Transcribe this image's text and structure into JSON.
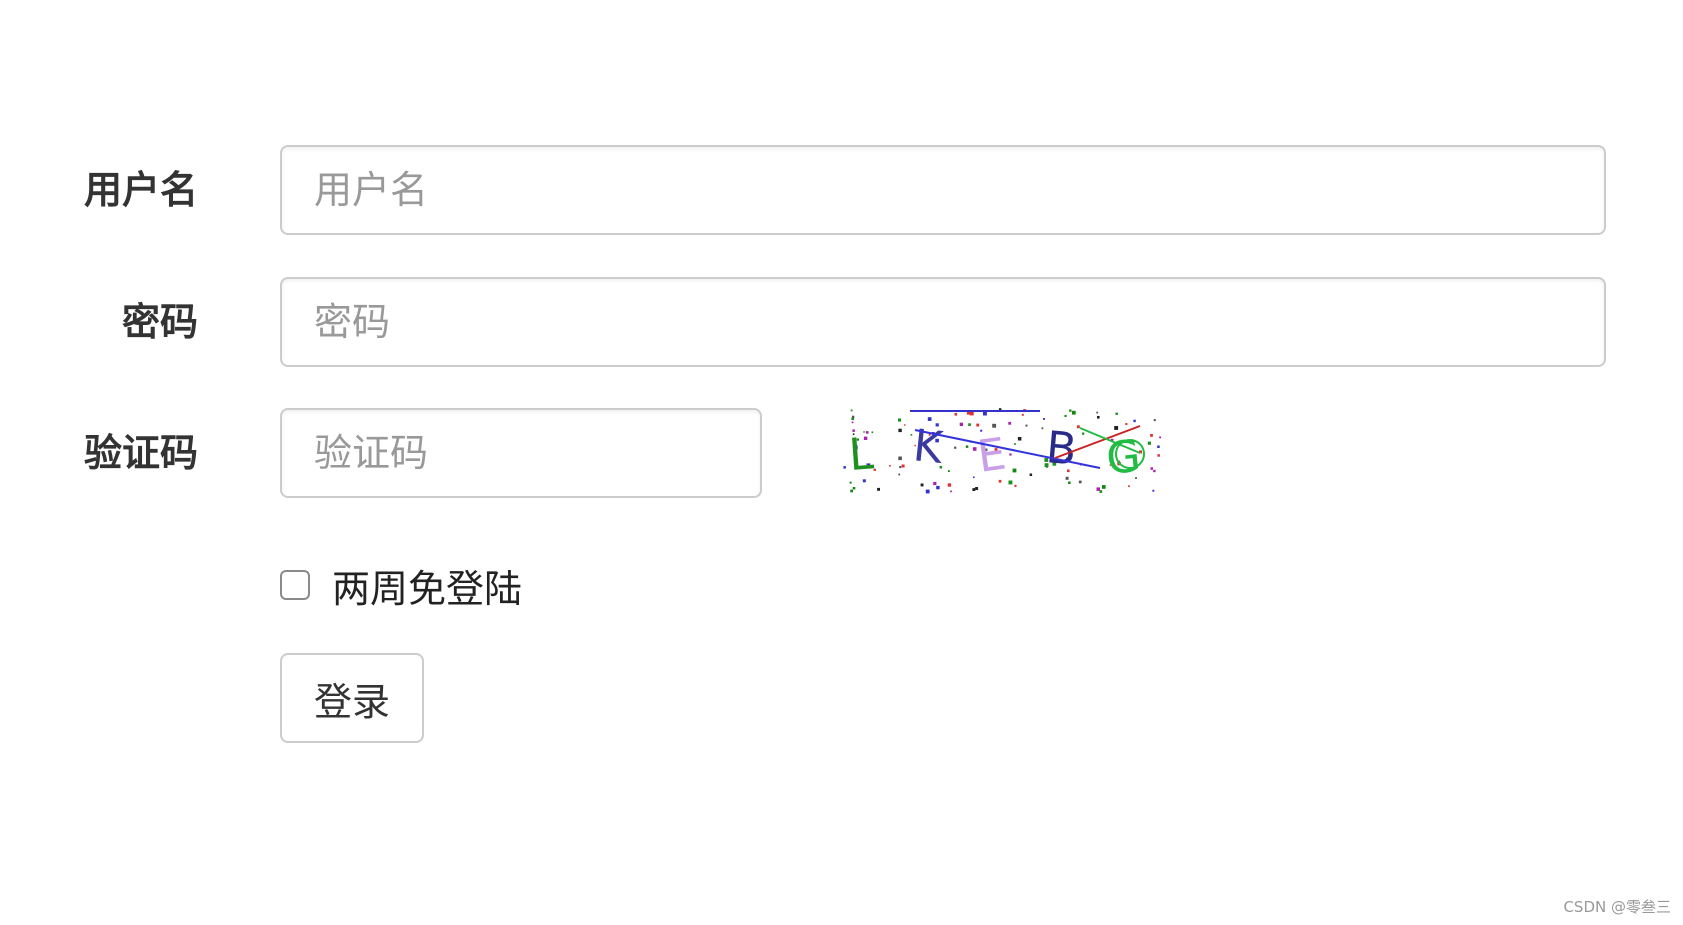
{
  "form": {
    "username": {
      "label": "用户名",
      "placeholder": "用户名",
      "value": ""
    },
    "password": {
      "label": "密码",
      "placeholder": "密码",
      "value": ""
    },
    "captcha": {
      "label": "验证码",
      "placeholder": "验证码",
      "value": "",
      "image_text": "LKEBG",
      "image_colors": [
        "#1f8f1f",
        "#3a3aa0",
        "#c9a0e8",
        "#2a2a8a",
        "#22bb44"
      ]
    },
    "remember": {
      "label": "两周免登陆",
      "checked": false
    },
    "submit_label": "登录"
  },
  "watermark": "CSDN @零叁三"
}
